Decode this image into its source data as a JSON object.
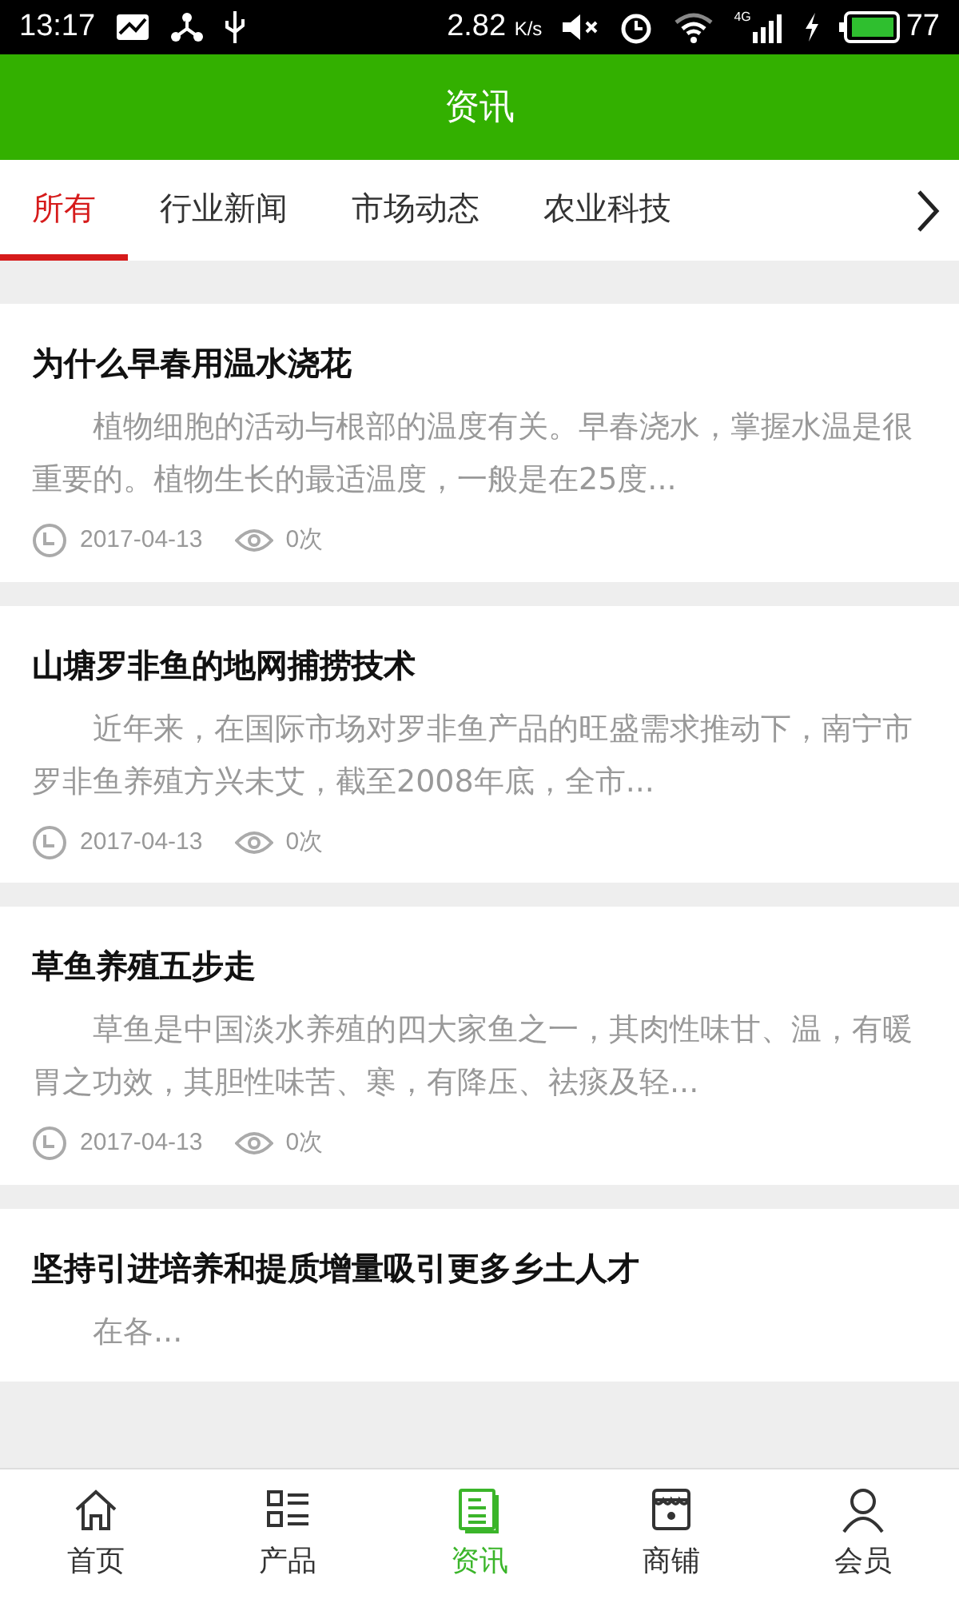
{
  "status_bar": {
    "time": "13:17",
    "speed": "2.82",
    "speed_unit": "K/s",
    "network": "4G",
    "battery": "77"
  },
  "header": {
    "title": "资讯"
  },
  "tabs": [
    {
      "label": "所有",
      "selected": true
    },
    {
      "label": "行业新闻",
      "selected": false
    },
    {
      "label": "市场动态",
      "selected": false
    },
    {
      "label": "农业科技",
      "selected": false
    }
  ],
  "articles": [
    {
      "title": "为什么早春用温水浇花",
      "summary": "　　植物细胞的活动与根部的温度有关。早春浇水，掌握水温是很重要的。植物生长的最适温度，一般是在25度...",
      "date": "2017-04-13",
      "views": "0次"
    },
    {
      "title": "山塘罗非鱼的地网捕捞技术",
      "summary": "　　近年来，在国际市场对罗非鱼产品的旺盛需求推动下，南宁市罗非鱼养殖方兴未艾，截至2008年底，全市...",
      "date": "2017-04-13",
      "views": "0次"
    },
    {
      "title": "草鱼养殖五步走",
      "summary": "　　草鱼是中国淡水养殖的四大家鱼之一，其肉性味甘、温，有暖胃之功效，其胆性味苦、寒，有降压、祛痰及轻...",
      "date": "2017-04-13",
      "views": "0次"
    },
    {
      "title": "坚持引进培养和提质增量吸引更多乡土人才",
      "summary": "　　在各..."
    }
  ],
  "bottom_nav": [
    {
      "kind": "home",
      "label": "首页",
      "selected": false
    },
    {
      "kind": "products",
      "label": "产品",
      "selected": false
    },
    {
      "kind": "news",
      "label": "资讯",
      "selected": true
    },
    {
      "kind": "shops",
      "label": "商铺",
      "selected": false
    },
    {
      "kind": "member",
      "label": "会员",
      "selected": false
    }
  ]
}
